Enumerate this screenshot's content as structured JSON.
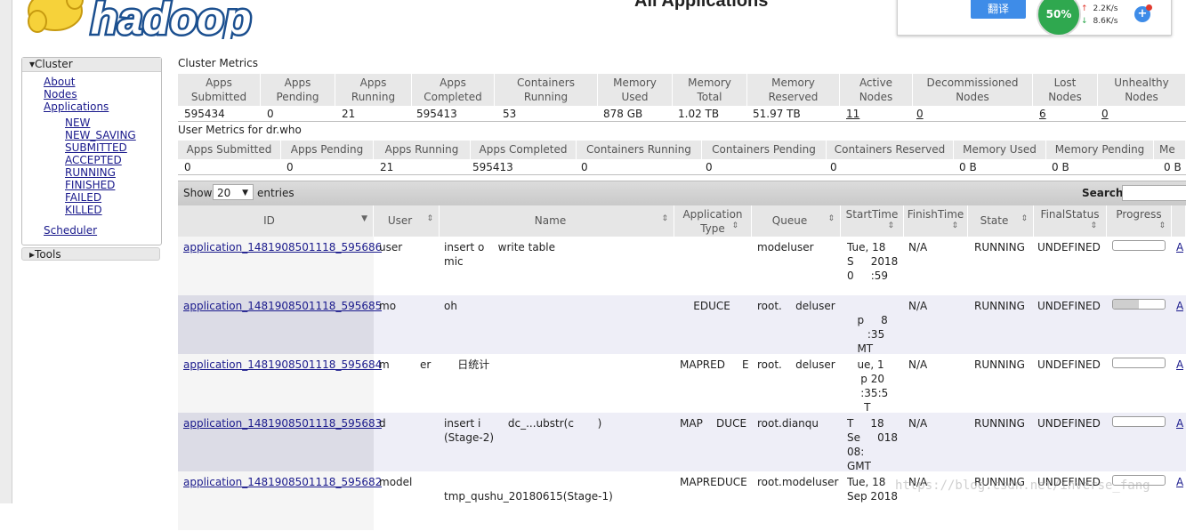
{
  "header": {
    "title": "All Applications",
    "logo_text": "hadoop"
  },
  "extension": {
    "translate_label": "翻译",
    "net_percent": "50%",
    "up_speed": "2.2K/s",
    "down_speed": "8.6K/s",
    "plus": "+"
  },
  "nav": {
    "cluster_label": "Cluster",
    "about": "About",
    "nodes": "Nodes",
    "applications": "Applications",
    "states": [
      "NEW",
      "NEW_SAVING",
      "SUBMITTED",
      "ACCEPTED",
      "RUNNING",
      "FINISHED",
      "FAILED",
      "KILLED"
    ],
    "scheduler": "Scheduler",
    "tools_label": "Tools"
  },
  "cluster_metrics": {
    "title": "Cluster Metrics",
    "headers": [
      "Apps\nSubmitted",
      "Apps\nPending",
      "Apps\nRunning",
      "Apps\nCompleted",
      "Containers\nRunning",
      "Memory\nUsed",
      "Memory\nTotal",
      "Memory\nReserved",
      "Active\nNodes",
      "Decommissioned\nNodes",
      "Lost\nNodes",
      "Unhealthy\nNodes"
    ],
    "values": [
      "595434",
      "0",
      "21",
      "595413",
      "53",
      "878 GB",
      "1.02 TB",
      "51.97 TB",
      "11",
      "0",
      "6",
      "0"
    ]
  },
  "user_metrics": {
    "title": "User Metrics for dr.who",
    "headers": [
      "Apps Submitted",
      "Apps Pending",
      "Apps Running",
      "Apps Completed",
      "Containers Running",
      "Containers Pending",
      "Containers Reserved",
      "Memory Used",
      "Memory Pending",
      "Me"
    ],
    "values": [
      "0",
      "0",
      "21",
      "595413",
      "0",
      "0",
      "0",
      "0 B",
      "0 B",
      "0 B"
    ]
  },
  "table_controls": {
    "show": "Show",
    "entries_value": "20",
    "entries": "entries",
    "search": "Search:"
  },
  "apps": {
    "headers": {
      "id": "ID",
      "user": "User",
      "name": "Name",
      "type": "Application\nType",
      "queue": "Queue",
      "start": "StartTime",
      "finish": "FinishTime",
      "state": "State",
      "final": "FinalStatus",
      "progress": "Progress"
    },
    "rows": [
      {
        "id": "application_1481908501118_595686",
        "user": "user",
        "name": "insert o    write table\nmic",
        "type": "",
        "queue": "modeluser",
        "start": "Tue, 18\nS     2018\n0     :59",
        "finish": "N/A",
        "state": "RUNNING",
        "final": "UNDEFINED",
        "progress": 0.0,
        "extra": "A"
      },
      {
        "id": "application_1481908501118_595685",
        "user": "mo",
        "name": "oh",
        "type": "    EDUCE",
        "queue": "root.    deluser",
        "start": "\n   p     8\n      :35\n   MT",
        "finish": "N/A",
        "state": "RUNNING",
        "final": "UNDEFINED",
        "progress": 0.5,
        "extra": "A"
      },
      {
        "id": "application_1481908501118_595684",
        "user": "m         er",
        "name": "    日统计",
        "type": "MAPRED     E",
        "queue": "root.    deluser",
        "start": "   ue, 1\n    p 20\n    :35:5\n     T",
        "finish": "N/A",
        "state": "RUNNING",
        "final": "UNDEFINED",
        "progress": 0.0,
        "extra": "A"
      },
      {
        "id": "application_1481908501118_595683",
        "user": "d",
        "name": "insert i        dc_...ubstr(c       )\n(Stage-2)",
        "type": "MAP    DUCE",
        "queue": "root.dianqu",
        "start": "T     18\nSe     018\n08:\nGMT",
        "finish": "N/A",
        "state": "RUNNING",
        "final": "UNDEFINED",
        "progress": 0.0,
        "extra": "A"
      },
      {
        "id": "application_1481908501118_595682",
        "user": "model",
        "name": "\ntmp_qushu_20180615(Stage-1)",
        "type": "MAPREDUCE",
        "queue": "root.modeluser",
        "start": "Tue, 18\nSep 2018",
        "finish": "N/A",
        "state": "RUNNING",
        "final": "UNDEFINED",
        "progress": 0.0,
        "extra": "A"
      }
    ]
  },
  "watermark": "https://blog.csdn.net/inverse_fang",
  "colors": {
    "link": "#1a1a8c",
    "header_bg": "#e6e6e6",
    "row_even": "#eeeef7",
    "translate": "#3e8ce8",
    "ball": "#2fa84f"
  }
}
